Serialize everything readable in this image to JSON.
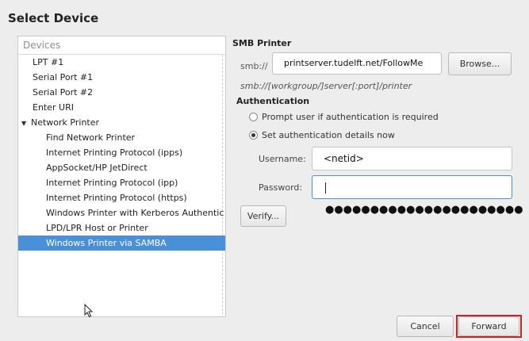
{
  "dialog": {
    "title": "Select Device"
  },
  "devices": {
    "header": "Devices",
    "items": [
      {
        "label": "LPT #1",
        "level": 0
      },
      {
        "label": "Serial Port #1",
        "level": 0
      },
      {
        "label": "Serial Port #2",
        "level": 0
      },
      {
        "label": "Enter URI",
        "level": 0
      },
      {
        "label": "Network Printer",
        "level": 0,
        "expanded": true
      },
      {
        "label": "Find Network Printer",
        "level": 1
      },
      {
        "label": "Internet Printing Protocol (ipps)",
        "level": 1
      },
      {
        "label": "AppSocket/HP JetDirect",
        "level": 1
      },
      {
        "label": "Internet Printing Protocol (ipp)",
        "level": 1
      },
      {
        "label": "Internet Printing Protocol (https)",
        "level": 1
      },
      {
        "label": "Windows Printer with Kerberos Authentic",
        "level": 1
      },
      {
        "label": "LPD/LPR Host or Printer",
        "level": 1
      },
      {
        "label": "Windows Printer via SAMBA",
        "level": 1,
        "selected": true
      }
    ]
  },
  "smb": {
    "section_title": "SMB Printer",
    "prefix": "smb://",
    "uri_value": "printserver.tudelft.net/FollowMe",
    "browse_label": "Browse...",
    "hint": "smb://[workgroup/]server[:port]/printer"
  },
  "auth": {
    "section_title": "Authentication",
    "prompt_option": "Prompt user if authentication is required",
    "set_option": "Set authentication details now",
    "selected_option": "set",
    "username_label": "Username:",
    "username_value": "<netid>",
    "password_label": "Password:",
    "password_mask": "●●●●●●●●●●●●●●●●●●●●●●",
    "verify_label": "Verify..."
  },
  "footer": {
    "cancel_label": "Cancel",
    "forward_label": "Forward"
  },
  "colors": {
    "selection": "#4a90d9",
    "highlight_border": "#d0202a"
  },
  "icons": {
    "mouse_cursor": "pointer-arrow-icon",
    "expander": "triangle-down-icon"
  }
}
